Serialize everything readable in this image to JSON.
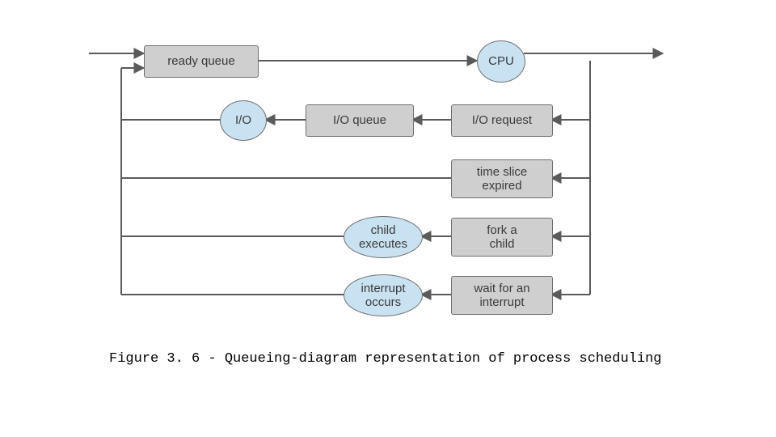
{
  "nodes": {
    "ready_queue": "ready queue",
    "cpu": "CPU",
    "io": "I/O",
    "io_queue": "I/O queue",
    "io_request": "I/O request",
    "time_slice": "time slice\nexpired",
    "child_exec": "child\nexecutes",
    "fork_child": "fork a\nchild",
    "interrupt_occurs": "interrupt\noccurs",
    "wait_interrupt": "wait for an\ninterrupt"
  },
  "caption": "Figure 3. 6 - Queueing-diagram representation of process scheduling"
}
